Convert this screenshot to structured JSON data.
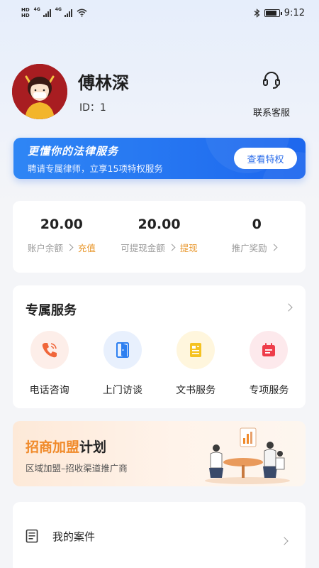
{
  "status_bar": {
    "time": "9:12",
    "network_labels": [
      "HD",
      "HD"
    ],
    "signal_type": "4G"
  },
  "profile": {
    "name": "傅林深",
    "id_text": "ID：1",
    "avatar_icon": "avatar-icon"
  },
  "customer_service": {
    "label": "联系客服",
    "icon": "headset-icon"
  },
  "legal_banner": {
    "title": "更懂你的法律服务",
    "subtitle": "聘请专属律师，立享15项特权服务",
    "button_label": "查看特权",
    "colors": {
      "start": "#2f86f5",
      "end": "#1d67ee"
    }
  },
  "balances": [
    {
      "value": "20.00",
      "label": "账户余额",
      "action": "充值"
    },
    {
      "value": "20.00",
      "label": "可提现金额",
      "action": "提现"
    },
    {
      "value": "0",
      "label": "推广奖励",
      "action": ""
    }
  ],
  "services": {
    "title": "专属服务",
    "items": [
      {
        "label": "电话咨询",
        "icon": "phone-icon",
        "bg": "#fdeee9",
        "color": "#f0663a"
      },
      {
        "label": "上门访谈",
        "icon": "door-icon",
        "bg": "#e8f0fd",
        "color": "#2d7ff0"
      },
      {
        "label": "文书服务",
        "icon": "document-icon",
        "bg": "#fff6dd",
        "color": "#f5c221"
      },
      {
        "label": "专项服务",
        "icon": "calendar-icon",
        "bg": "#fde9ec",
        "color": "#ee3d4a"
      }
    ]
  },
  "franchise": {
    "title_highlight": "招商加盟",
    "title_rest": "计划",
    "subtitle": "区域加盟–招收渠道推广商",
    "accent": "#f08a2a"
  },
  "menu": [
    {
      "label": "我的案件",
      "icon": "case-icon"
    }
  ]
}
